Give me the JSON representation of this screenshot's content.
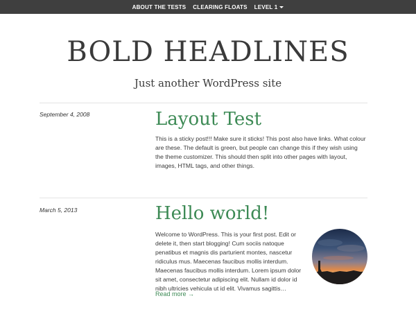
{
  "nav": {
    "items": [
      {
        "label": "ABOUT THE TESTS"
      },
      {
        "label": "CLEARING FLOATS"
      },
      {
        "label": "LEVEL 1"
      }
    ]
  },
  "header": {
    "title": "BOLD HEADLINES",
    "tagline": "Just another WordPress site"
  },
  "posts": [
    {
      "date": "September 4, 2008",
      "title": "Layout Test",
      "excerpt": "This is a sticky post!!! Make sure it sticks! This post also have links. What colour are these. The default is green, but people can change this if they wish using the theme customizer. This should then split into other pages with layout, images, HTML tags, and other things."
    },
    {
      "date": "March 5, 2013",
      "title": "Hello world!",
      "excerpt": "Welcome to WordPress. This is your first post. Edit or delete it, then start blogging! Cum sociis natoque penatibus et magnis dis parturient montes, nascetur ridiculus mus. Maecenas faucibus mollis interdum. Maecenas faucibus mollis interdum. Lorem ipsum dolor sit amet, consectetur adipiscing elit. Nullam id dolor id nibh ultricies vehicula ut id elit. Vivamus sagittis…",
      "read_more": "Read more →"
    }
  ],
  "colors": {
    "nav_bg": "#3f3f3f",
    "accent": "#3d8a55",
    "text": "#3a3a3a"
  }
}
